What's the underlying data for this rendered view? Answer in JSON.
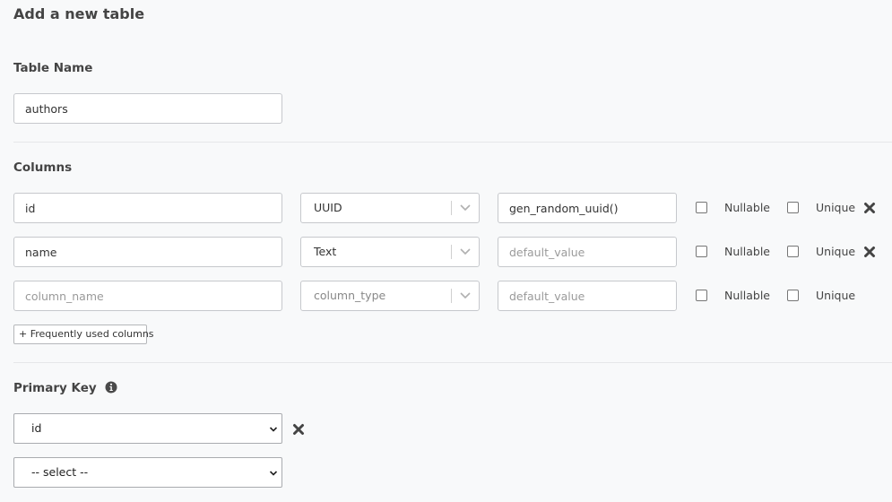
{
  "page": {
    "title": "Add a new table"
  },
  "table_name": {
    "label": "Table Name",
    "value": "authors"
  },
  "columns": {
    "label": "Columns",
    "rows": [
      {
        "name": "id",
        "name_placeholder": "column_name",
        "type": "UUID",
        "type_placeholder": "column_type",
        "default": "gen_random_uuid()",
        "default_placeholder": "default_value",
        "nullable_label": "Nullable",
        "nullable": false,
        "unique_label": "Unique",
        "unique": false,
        "removable": true
      },
      {
        "name": "name",
        "name_placeholder": "column_name",
        "type": "Text",
        "type_placeholder": "column_type",
        "default": "",
        "default_placeholder": "default_value",
        "nullable_label": "Nullable",
        "nullable": false,
        "unique_label": "Unique",
        "unique": false,
        "removable": true
      },
      {
        "name": "",
        "name_placeholder": "column_name",
        "type": "",
        "type_placeholder": "column_type",
        "default": "",
        "default_placeholder": "default_value",
        "nullable_label": "Nullable",
        "nullable": false,
        "unique_label": "Unique",
        "unique": false,
        "removable": false
      }
    ],
    "frequently_used_button": "+ Frequently used columns"
  },
  "primary_key": {
    "label": "Primary Key",
    "selected": "id",
    "new_select_placeholder": "-- select --"
  },
  "icons": {
    "remove": "close-icon",
    "info": "info-icon",
    "chevron": "chevron-down-icon"
  },
  "colors": {
    "background": "#f8f9fa",
    "border": "#c6c8cc",
    "text": "#333333",
    "placeholder": "#9a9a9a"
  }
}
